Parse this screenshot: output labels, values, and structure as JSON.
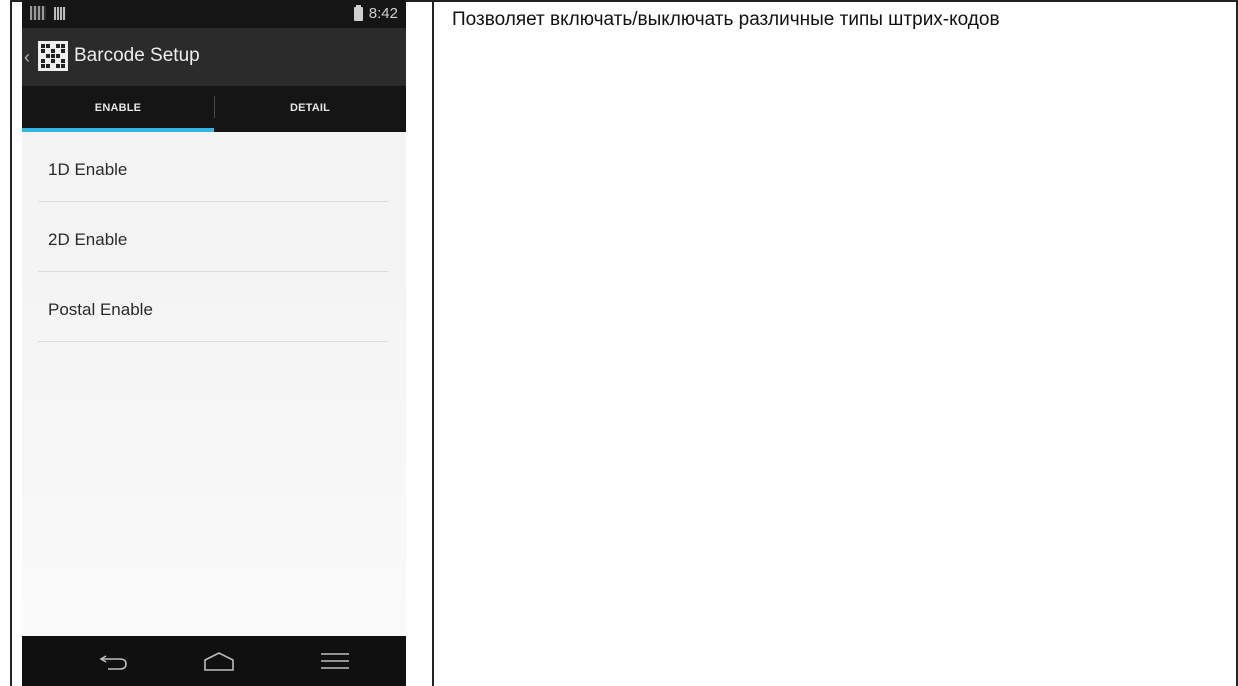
{
  "status_bar": {
    "time": "8:42"
  },
  "action_bar": {
    "back_icon": "chevron-left-icon",
    "app_icon": "qr-code-icon",
    "title": "Barcode Setup"
  },
  "tabs": [
    {
      "label": "ENABLE",
      "selected": true
    },
    {
      "label": "DETAIL",
      "selected": false
    }
  ],
  "list": {
    "items": [
      {
        "label": "1D Enable"
      },
      {
        "label": "2D Enable"
      },
      {
        "label": "Postal Enable"
      }
    ]
  },
  "nav": {
    "back_icon": "back-arrow-icon",
    "home_icon": "home-icon",
    "menu_icon": "menu-icon"
  },
  "description": {
    "text": "Позволяет включать/выключать различные типы штрих-кодов"
  },
  "colors": {
    "accent": "#33b5e5",
    "action_bar": "#2b2b2b",
    "status_bar": "#151515"
  }
}
